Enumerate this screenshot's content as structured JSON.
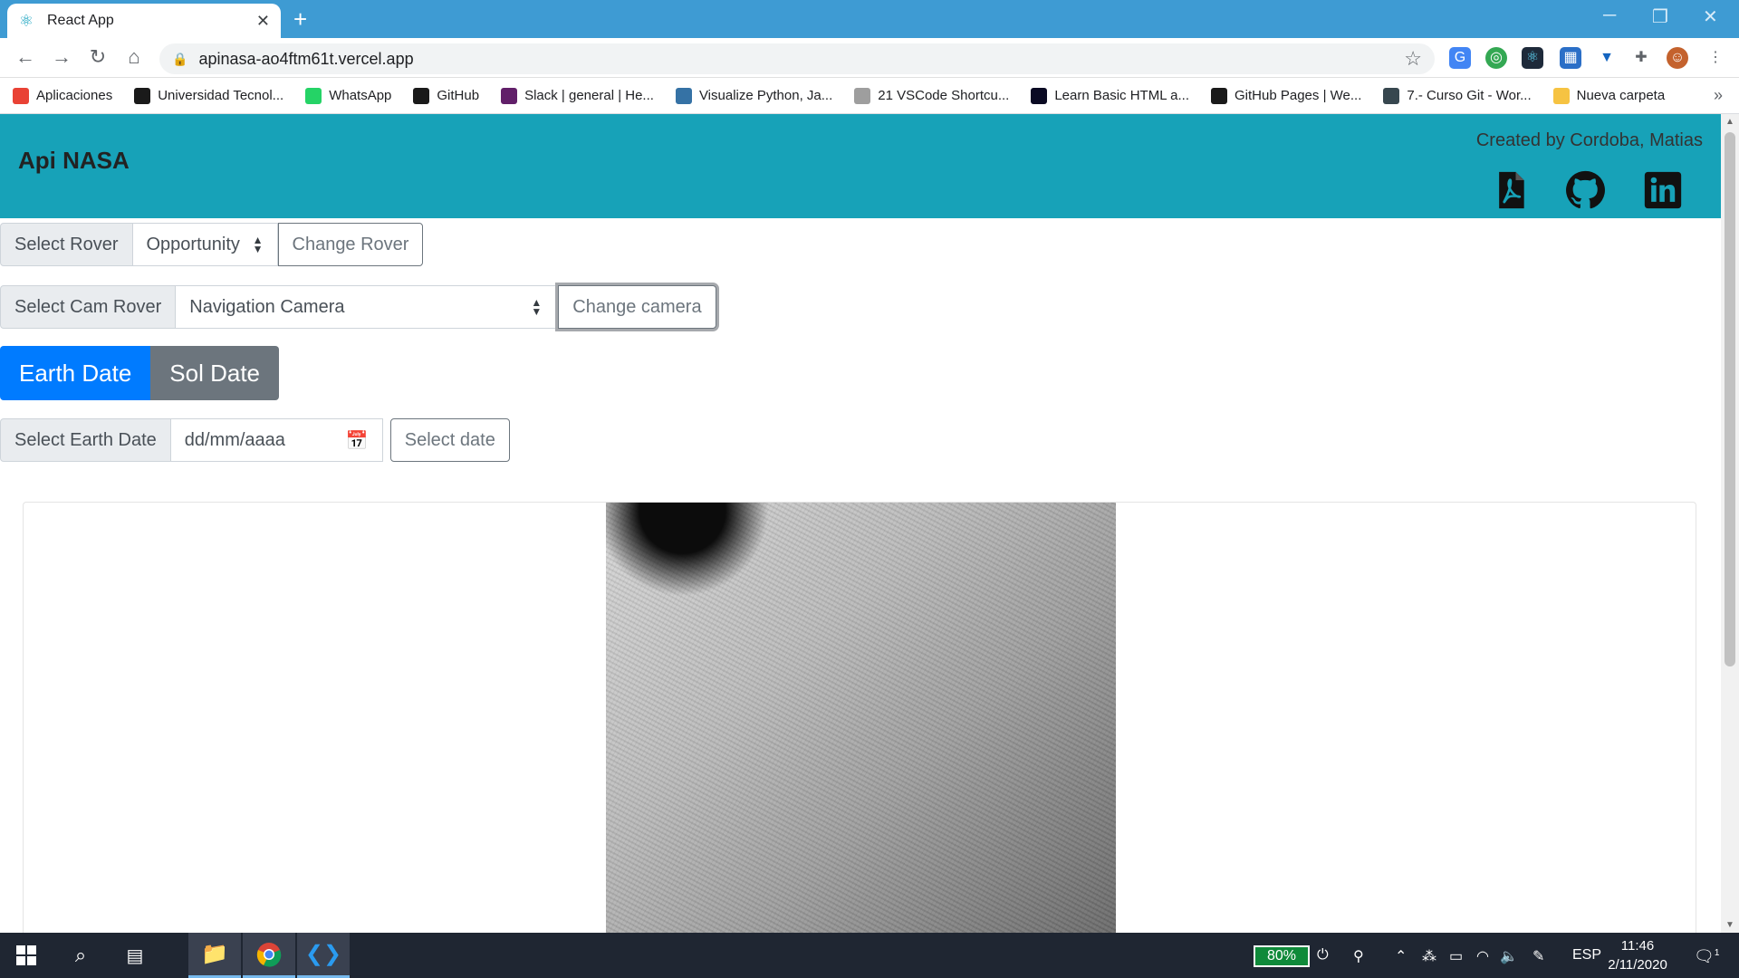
{
  "browser": {
    "tab_title": "React App",
    "new_tab": "+",
    "url": "apinasa-ao4ftm61t.vercel.app"
  },
  "bookmarks": [
    {
      "label": "Aplicaciones",
      "icon": "apps-grid-icon",
      "color": "#e94235"
    },
    {
      "label": "Universidad Tecnol...",
      "icon": "utn-icon",
      "color": "#1a1a1a"
    },
    {
      "label": "WhatsApp",
      "icon": "whatsapp-icon",
      "color": "#25d366"
    },
    {
      "label": "GitHub",
      "icon": "github-icon",
      "color": "#1a1a1a"
    },
    {
      "label": "Slack | general | He...",
      "icon": "slack-icon",
      "color": "#611f69"
    },
    {
      "label": "Visualize Python, Ja...",
      "icon": "python-icon",
      "color": "#3572a5"
    },
    {
      "label": "21 VSCode Shortcu...",
      "icon": "dash-icon",
      "color": "#9e9e9e"
    },
    {
      "label": "Learn Basic HTML a...",
      "icon": "freecodecamp-icon",
      "color": "#0a0a23"
    },
    {
      "label": "GitHub Pages | We...",
      "icon": "github-icon",
      "color": "#1a1a1a"
    },
    {
      "label": "7.- Curso Git - Wor...",
      "icon": "doc-icon",
      "color": "#37474f"
    },
    {
      "label": "Nueva carpeta",
      "icon": "folder-icon",
      "color": "#f6c342"
    }
  ],
  "bookmarks_more": "»",
  "header": {
    "brand": "Api NASA",
    "credit": "Created by Cordoba, Matias"
  },
  "rover": {
    "label": "Select Rover",
    "selected": "Opportunity",
    "button": "Change Rover"
  },
  "camera": {
    "label": "Select Cam Rover",
    "selected": "Navigation Camera",
    "button": "Change camera"
  },
  "date_toggle": {
    "earth": "Earth Date",
    "sol": "Sol Date"
  },
  "earth_date": {
    "label": "Select Earth Date",
    "placeholder": "dd/mm/aaaa",
    "button": "Select date"
  },
  "taskbar": {
    "battery": "80%",
    "language": "ESP",
    "time": "11:46",
    "date": "2/11/2020",
    "notifications": "1"
  }
}
